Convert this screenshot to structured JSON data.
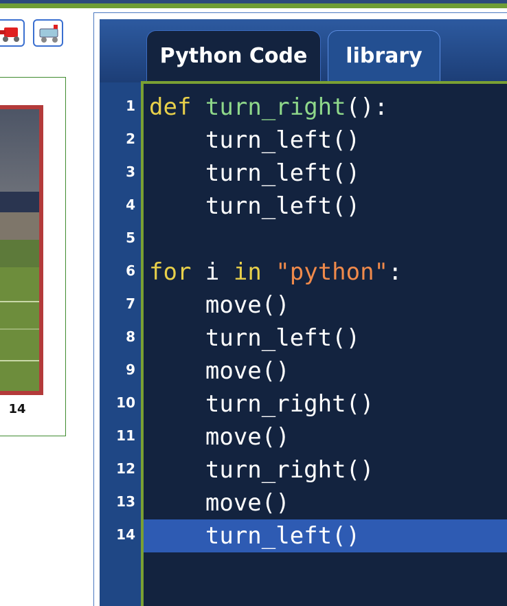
{
  "tools": {
    "robot_button_1": "robot-icon",
    "robot_button_2": "robot-cart-icon"
  },
  "world": {
    "counter": "14"
  },
  "editor": {
    "tabs": [
      {
        "label": "Python Code",
        "active": true
      },
      {
        "label": "library",
        "active": false
      }
    ],
    "active_line": 14,
    "lines": [
      {
        "n": "1",
        "parts": [
          {
            "t": "def",
            "c": "kw"
          },
          {
            "t": " "
          },
          {
            "t": "turn_right",
            "c": "fn"
          },
          {
            "t": "():"
          }
        ]
      },
      {
        "n": "2",
        "parts": [
          {
            "t": "    turn_left()"
          }
        ]
      },
      {
        "n": "3",
        "parts": [
          {
            "t": "    turn_left()"
          }
        ]
      },
      {
        "n": "4",
        "parts": [
          {
            "t": "    turn_left()"
          }
        ]
      },
      {
        "n": "5",
        "parts": [
          {
            "t": ""
          }
        ]
      },
      {
        "n": "6",
        "parts": [
          {
            "t": "for",
            "c": "kw"
          },
          {
            "t": " i "
          },
          {
            "t": "in",
            "c": "kw"
          },
          {
            "t": " "
          },
          {
            "t": "\"python\"",
            "c": "str"
          },
          {
            "t": ":"
          }
        ]
      },
      {
        "n": "7",
        "parts": [
          {
            "t": "    move()"
          }
        ]
      },
      {
        "n": "8",
        "parts": [
          {
            "t": "    turn_left()"
          }
        ]
      },
      {
        "n": "9",
        "parts": [
          {
            "t": "    move()"
          }
        ]
      },
      {
        "n": "10",
        "parts": [
          {
            "t": "    turn_right()"
          }
        ]
      },
      {
        "n": "11",
        "parts": [
          {
            "t": "    move()"
          }
        ]
      },
      {
        "n": "12",
        "parts": [
          {
            "t": "    turn_right()"
          }
        ]
      },
      {
        "n": "13",
        "parts": [
          {
            "t": "    move()"
          }
        ]
      },
      {
        "n": "14",
        "parts": [
          {
            "t": "    turn_left()"
          }
        ]
      }
    ]
  }
}
